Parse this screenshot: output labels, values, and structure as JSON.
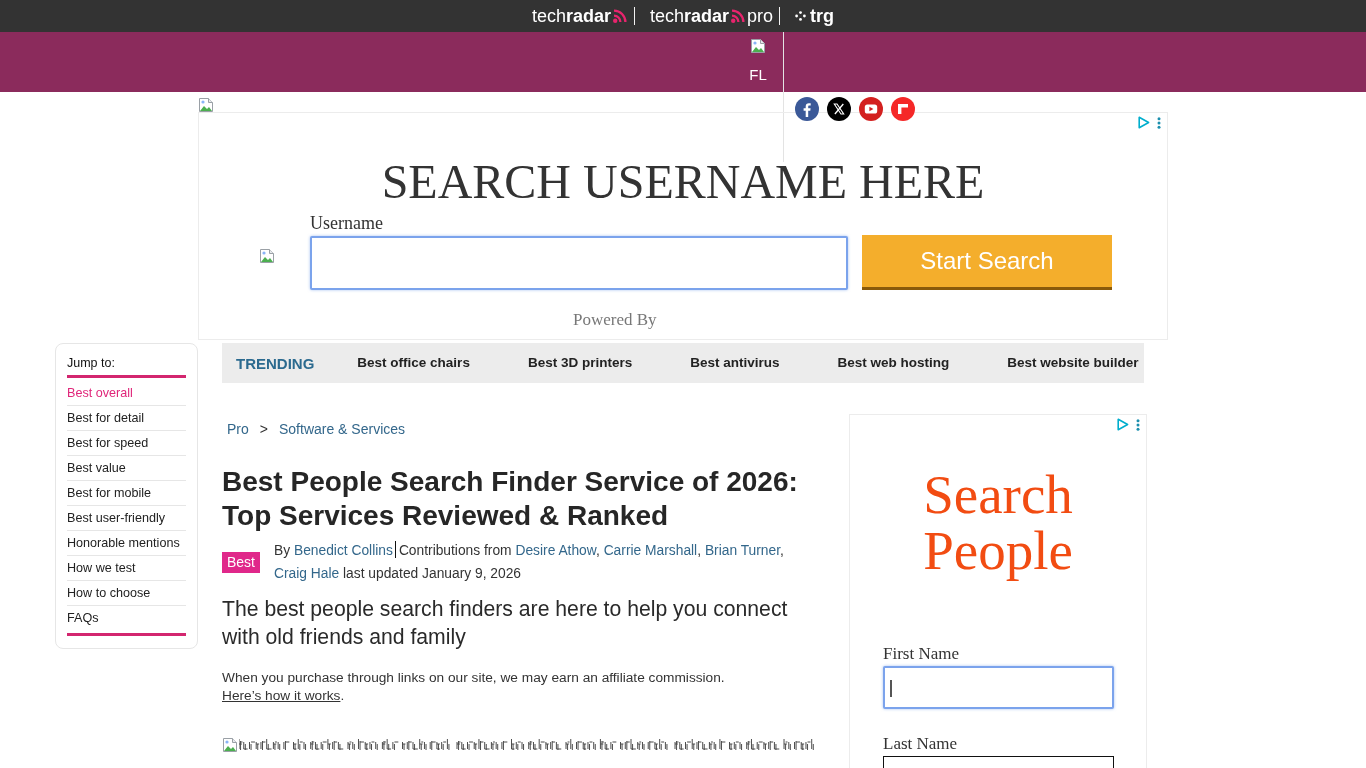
{
  "top_bar": {
    "brands": [
      {
        "kind": "radar",
        "name": "tech**radar**"
      },
      {
        "kind": "radar",
        "name": "tech**radar**",
        "suffix": "pro"
      },
      {
        "kind": "dots",
        "name": "trg"
      }
    ]
  },
  "promo_bar": {
    "label": "FL"
  },
  "top_ad": {
    "heading": "SEARCH USERNAME HERE",
    "field": {
      "label": "Username",
      "focused": true
    },
    "button": "Start Search",
    "footer": "Powered By"
  },
  "sidebar": {
    "title": "Jump to:",
    "items": [
      {
        "label": "Best overall",
        "selected": true
      },
      {
        "label": "Best for detail",
        "selected": false
      },
      {
        "label": "Best for speed",
        "selected": false
      },
      {
        "label": "Best value",
        "selected": false
      },
      {
        "label": "Best for mobile",
        "selected": false
      },
      {
        "label": "Best user-friendly",
        "selected": false
      },
      {
        "label": "Honorable mentions",
        "selected": false
      },
      {
        "label": "How we test",
        "selected": false
      },
      {
        "label": "How to choose",
        "selected": false
      },
      {
        "label": "FAQs",
        "selected": false
      }
    ]
  },
  "trending": {
    "label": "TRENDING",
    "items": [
      "Best office chairs",
      "Best 3D printers",
      "Best antivirus",
      "Best web hosting",
      "Best website builder"
    ]
  },
  "breadcrumb": {
    "items": [
      "Pro",
      "Software & Services"
    ],
    "separator": ">"
  },
  "article": {
    "title": "Best People Search Finder Service of 2026: Top Services Reviewed & Ranked",
    "badge": "Best",
    "byline": {
      "prefix": "By",
      "author": "Benedict Collins",
      "contributions_label": "Contributions from",
      "contributors": [
        {
          "name": "Desire Athow",
          "separator": ","
        },
        {
          "name": "Carrie Marshall",
          "separator": ","
        },
        {
          "name": "Brian Turner",
          "separator": ","
        },
        {
          "name": "Craig Hale"
        }
      ],
      "updated": "last updated January 9, 2026"
    },
    "subtitle": "The best people search finders are here to help you connect with old friends and family",
    "disclosure": {
      "text": "When you purchase through links on our site, we may earn an affiliate commission.",
      "link": "Here’s how it works",
      "end": "."
    }
  },
  "side_ad": {
    "heading": "Search People",
    "fields": [
      {
        "label": "First Name",
        "focused": true
      },
      {
        "label": "Last Name",
        "focused": false
      }
    ]
  }
}
